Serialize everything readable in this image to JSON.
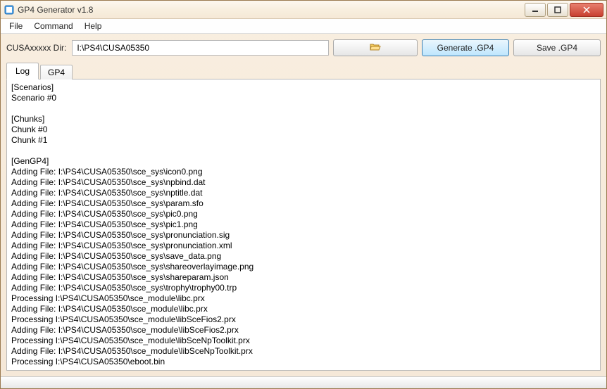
{
  "window": {
    "title": "GP4 Generator v1.8"
  },
  "menubar": {
    "items": [
      "File",
      "Command",
      "Help"
    ]
  },
  "toolbar": {
    "dir_label": "CUSAxxxxx Dir:",
    "dir_value": "I:\\PS4\\CUSA05350",
    "browse_label": "",
    "generate_label": "Generate .GP4",
    "save_label": "Save .GP4"
  },
  "tabs": {
    "items": [
      "Log",
      "GP4"
    ],
    "active": 0
  },
  "log": [
    "[Scenarios]",
    "Scenario #0",
    "",
    "[Chunks]",
    "Chunk #0",
    "Chunk #1",
    "",
    "[GenGP4]",
    "Adding File: I:\\PS4\\CUSA05350\\sce_sys\\icon0.png",
    "Adding File: I:\\PS4\\CUSA05350\\sce_sys\\npbind.dat",
    "Adding File: I:\\PS4\\CUSA05350\\sce_sys\\nptitle.dat",
    "Adding File: I:\\PS4\\CUSA05350\\sce_sys\\param.sfo",
    "Adding File: I:\\PS4\\CUSA05350\\sce_sys\\pic0.png",
    "Adding File: I:\\PS4\\CUSA05350\\sce_sys\\pic1.png",
    "Adding File: I:\\PS4\\CUSA05350\\sce_sys\\pronunciation.sig",
    "Adding File: I:\\PS4\\CUSA05350\\sce_sys\\pronunciation.xml",
    "Adding File: I:\\PS4\\CUSA05350\\sce_sys\\save_data.png",
    "Adding File: I:\\PS4\\CUSA05350\\sce_sys\\shareoverlayimage.png",
    "Adding File: I:\\PS4\\CUSA05350\\sce_sys\\shareparam.json",
    "Adding File: I:\\PS4\\CUSA05350\\sce_sys\\trophy\\trophy00.trp",
    "Processing I:\\PS4\\CUSA05350\\sce_module\\libc.prx",
    "Adding File: I:\\PS4\\CUSA05350\\sce_module\\libc.prx",
    "Processing I:\\PS4\\CUSA05350\\sce_module\\libSceFios2.prx",
    "Adding File: I:\\PS4\\CUSA05350\\sce_module\\libSceFios2.prx",
    "Processing I:\\PS4\\CUSA05350\\sce_module\\libSceNpToolkit.prx",
    "Adding File: I:\\PS4\\CUSA05350\\sce_module\\libSceNpToolkit.prx",
    "Processing I:\\PS4\\CUSA05350\\eboot.bin"
  ]
}
